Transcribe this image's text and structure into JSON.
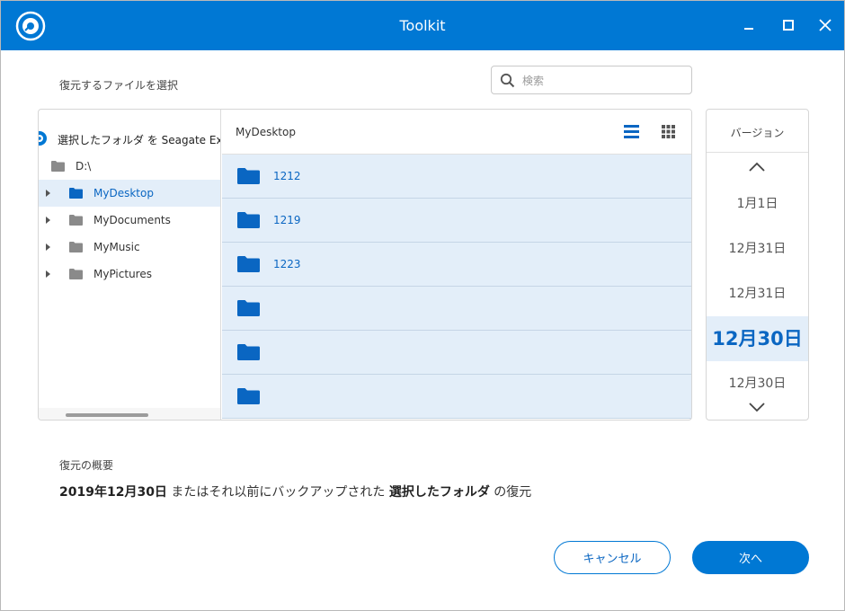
{
  "window": {
    "title": "Toolkit",
    "accent_color": "#0078d4",
    "minimize_icon": "minimize-icon",
    "maximize_icon": "maximize-icon",
    "close_icon": "close-icon"
  },
  "select_section": {
    "label": "復元するファイルを選択"
  },
  "search": {
    "placeholder": "検索",
    "value": ""
  },
  "tree": {
    "root_label": "選択したフォルダ を Seagate Expansi",
    "drive_label": "D:\\",
    "items": [
      {
        "label": "MyDesktop",
        "selected": true
      },
      {
        "label": "MyDocuments",
        "selected": false
      },
      {
        "label": "MyMusic",
        "selected": false
      },
      {
        "label": "MyPictures",
        "selected": false
      }
    ]
  },
  "files": {
    "current_path": "MyDesktop",
    "rows": [
      {
        "name": "1212"
      },
      {
        "name": "1219"
      },
      {
        "name": "1223"
      },
      {
        "name": ""
      },
      {
        "name": ""
      },
      {
        "name": ""
      }
    ]
  },
  "versions": {
    "header": "バージョン",
    "items": [
      {
        "label": "1月1日",
        "selected": false
      },
      {
        "label": "12月31日",
        "selected": false
      },
      {
        "label": "12月31日",
        "selected": false
      },
      {
        "label": "12月30日",
        "selected": true
      },
      {
        "label": "12月30日",
        "selected": false
      }
    ]
  },
  "summary": {
    "label": "復元の概要",
    "date": "2019年12月30日",
    "middle": " またはそれ以前にバックアップされた ",
    "target": "選択したフォルダ",
    "suffix": " の復元"
  },
  "buttons": {
    "cancel": "キャンセル",
    "next": "次へ"
  }
}
